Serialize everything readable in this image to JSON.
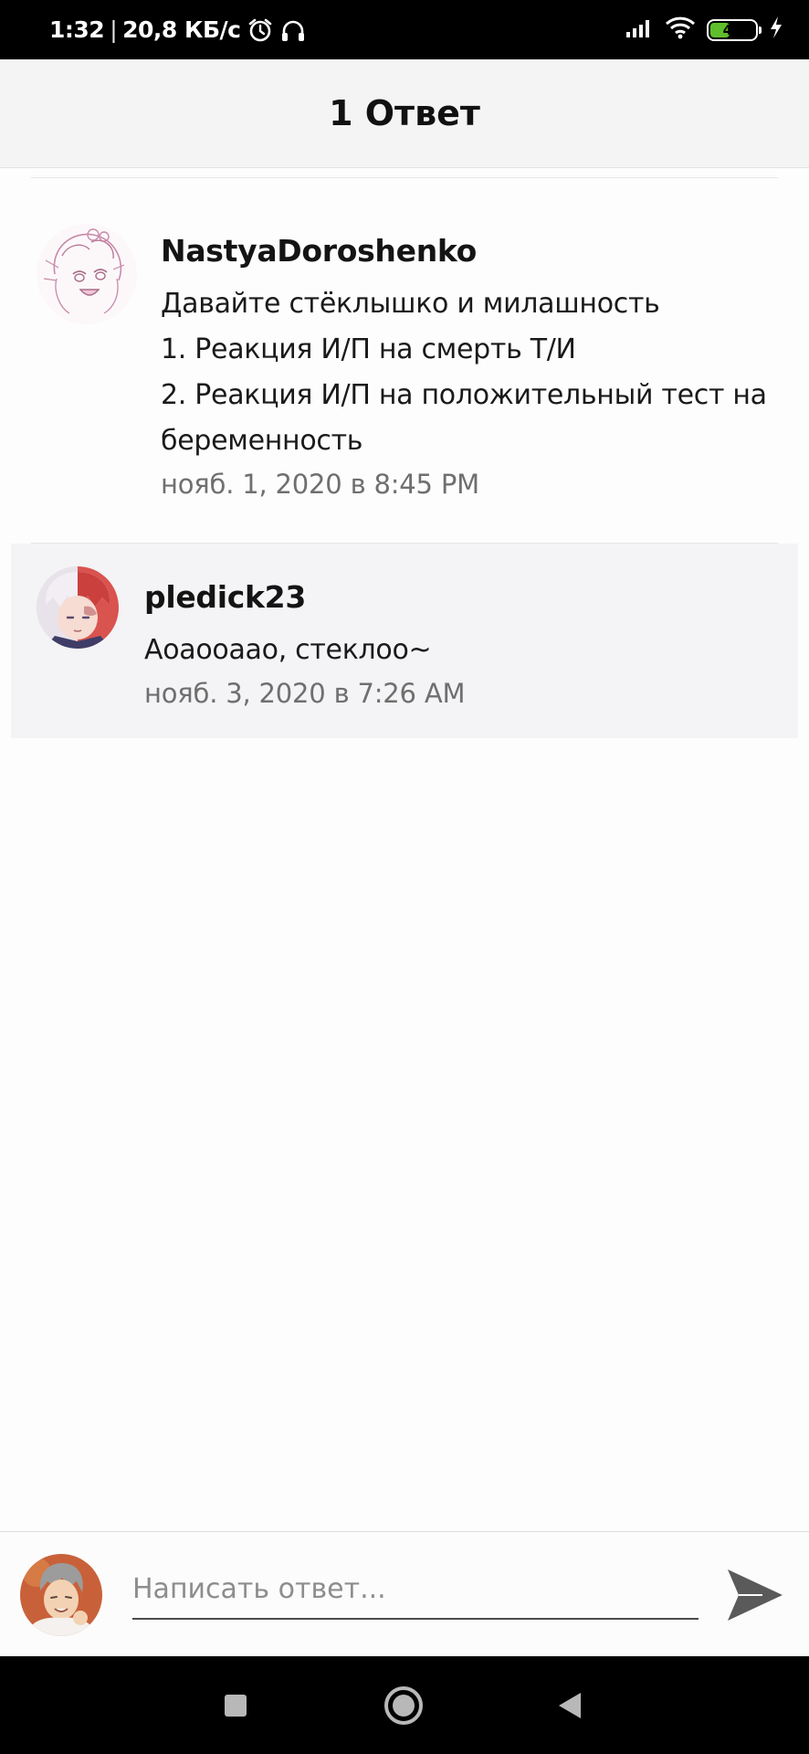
{
  "status_bar": {
    "time": "1:32",
    "separator": "|",
    "network_speed": "20,8 КБ/с",
    "icons": [
      "alarm-icon",
      "headphones-icon",
      "signal-icon",
      "wifi-icon",
      "battery-icon",
      "charging-icon"
    ],
    "battery_level": "43",
    "battery_fraction": 0.43,
    "battery_color": "#5fbe2c"
  },
  "header": {
    "title": "1 Ответ"
  },
  "comments": [
    {
      "author": "NastyaDoroshenko",
      "lines": [
        "Давайте стёклышко и милашность",
        "1. Реакция И/П на смерть Т/И",
        "2. Реакция И/П на положительный тест на",
        "беременность"
      ],
      "timestamp": "нояб. 1, 2020 в 8:45 PM"
    },
    {
      "author": "pledick23",
      "lines": [
        "Аоаооаао, стеклоо~"
      ],
      "timestamp": "нояб. 3, 2020 в 7:26 AM"
    }
  ],
  "reply_bar": {
    "placeholder": "Написать ответ...",
    "value": "",
    "send_icon": "send-icon",
    "accent_color": "#4a4a4a"
  },
  "nav_bar": {
    "icons": [
      "recent-apps-icon",
      "home-icon",
      "back-icon"
    ]
  }
}
